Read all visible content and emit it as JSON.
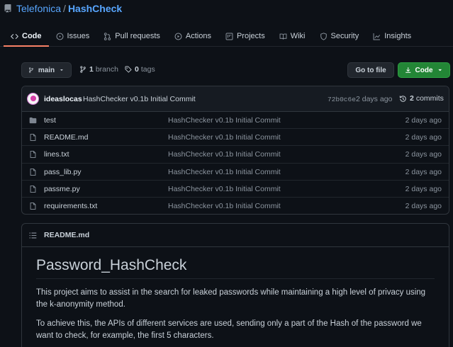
{
  "repo": {
    "owner": "Telefonica",
    "separator": "/",
    "name": "HashCheck"
  },
  "tabs": [
    {
      "label": "Code",
      "icon": "code-icon",
      "active": true
    },
    {
      "label": "Issues",
      "icon": "issue-icon"
    },
    {
      "label": "Pull requests",
      "icon": "pull-request-icon"
    },
    {
      "label": "Actions",
      "icon": "play-icon"
    },
    {
      "label": "Projects",
      "icon": "project-icon"
    },
    {
      "label": "Wiki",
      "icon": "book-icon"
    },
    {
      "label": "Security",
      "icon": "shield-icon"
    },
    {
      "label": "Insights",
      "icon": "graph-icon"
    }
  ],
  "branch_bar": {
    "branch": "main",
    "branch_count": "1",
    "branch_word": "branch",
    "tag_count": "0",
    "tag_word": "tags",
    "goto_file": "Go to file",
    "code_button": "Code"
  },
  "commit": {
    "author": "ideaslocas",
    "message": "HashChecker v0.1b Initial Commit",
    "hash": "72b0c6e",
    "date": "2 days ago",
    "count": "2",
    "count_word": "commits"
  },
  "files": [
    {
      "type": "folder",
      "name": "test",
      "message": "HashChecker v0.1b Initial Commit",
      "date": "2 days ago"
    },
    {
      "type": "file",
      "name": "README.md",
      "message": "HashChecker v0.1b Initial Commit",
      "date": "2 days ago"
    },
    {
      "type": "file",
      "name": "lines.txt",
      "message": "HashChecker v0.1b Initial Commit",
      "date": "2 days ago"
    },
    {
      "type": "file",
      "name": "pass_lib.py",
      "message": "HashChecker v0.1b Initial Commit",
      "date": "2 days ago"
    },
    {
      "type": "file",
      "name": "passme.py",
      "message": "HashChecker v0.1b Initial Commit",
      "date": "2 days ago"
    },
    {
      "type": "file",
      "name": "requirements.txt",
      "message": "HashChecker v0.1b Initial Commit",
      "date": "2 days ago"
    }
  ],
  "readme": {
    "filename": "README.md",
    "heading": "Password_HashCheck",
    "paragraphs": [
      "This project aims to assist in the search for leaked passwords while maintaining a high level of privacy using the k-anonymity method.",
      "To achieve this, the APIs of different services are used, sending only a part of the Hash of the password we want to check, for example, the first 5 characters."
    ]
  },
  "colors": {
    "accent": "#58a6ff",
    "active_tab": "#f78166",
    "primary_button": "#238636",
    "background": "#0d1117"
  }
}
